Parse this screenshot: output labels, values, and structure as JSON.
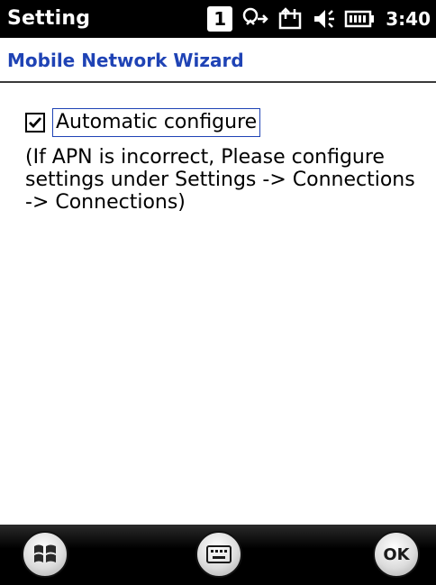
{
  "status_bar": {
    "app_title": "Setting",
    "sim_number": "1",
    "clock": "3:40",
    "icons": [
      "sim-badge-icon",
      "network-sync-icon",
      "data-connection-icon",
      "volume-icon",
      "battery-icon"
    ]
  },
  "page": {
    "heading": "Mobile Network Wizard"
  },
  "content": {
    "checkbox_label": "Automatic configure",
    "checkbox_checked": true,
    "note": "(If APN is incorrect, Please configure settings under Settings -> Connections -> Connections)"
  },
  "softkeys": {
    "start_icon": "windows-start-icon",
    "keyboard_icon": "keyboard-icon",
    "ok_label": "OK"
  },
  "colors": {
    "heading": "#1f43b5",
    "bar_background": "#000000",
    "page_background": "#ffffff"
  }
}
